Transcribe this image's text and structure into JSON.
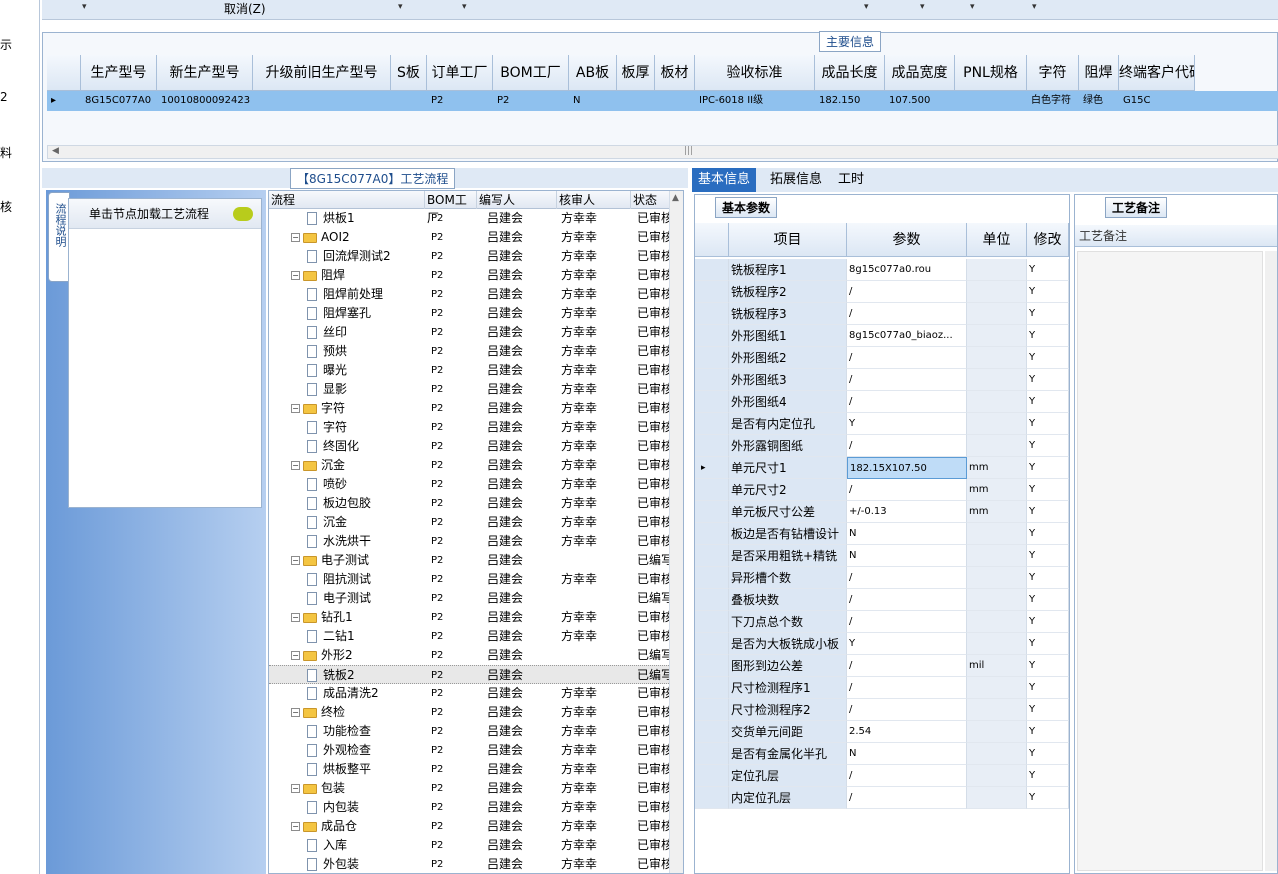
{
  "left_strip": {
    "items": [
      "示",
      "2",
      "料",
      "核"
    ]
  },
  "toolbar": {
    "cancel_label": "取消(Z)"
  },
  "main_panel": {
    "tab_label": "主要信息",
    "columns": [
      "生产型号",
      "新生产型号",
      "升级前旧生产型号",
      "S板",
      "订单工厂",
      "BOM工厂",
      "AB板",
      "板厚",
      "板材",
      "验收标准",
      "成品长度",
      "成品宽度",
      "PNL规格",
      "字符",
      "阻焊",
      "终端客户代码"
    ],
    "row": [
      "8G15C077A0",
      "10010800092423",
      "",
      "",
      "P2",
      "P2",
      "N",
      "",
      "",
      "IPC-6018 II级",
      "182.150",
      "107.500",
      "",
      "白色字符",
      "绿色",
      "G15C"
    ]
  },
  "flow": {
    "title": "【8G15C077A0】工艺流程",
    "side_tab": "流程说明",
    "node_hint": "单击节点加载工艺流程",
    "columns": [
      "流程",
      "BOM工厂",
      "编写人",
      "核审人",
      "状态"
    ],
    "rows": [
      {
        "name": "烘板1",
        "level": 2,
        "folder": false,
        "factory": "P2",
        "writer": "吕建会",
        "reviewer": "方幸幸",
        "status": "已审核"
      },
      {
        "name": "AOI2",
        "level": 1,
        "folder": true,
        "factory": "P2",
        "writer": "吕建会",
        "reviewer": "方幸幸",
        "status": "已审核"
      },
      {
        "name": "回流焊测试2",
        "level": 2,
        "folder": false,
        "factory": "P2",
        "writer": "吕建会",
        "reviewer": "方幸幸",
        "status": "已审核"
      },
      {
        "name": "阻焊",
        "level": 1,
        "folder": true,
        "factory": "P2",
        "writer": "吕建会",
        "reviewer": "方幸幸",
        "status": "已审核"
      },
      {
        "name": "阻焊前处理",
        "level": 2,
        "folder": false,
        "factory": "P2",
        "writer": "吕建会",
        "reviewer": "方幸幸",
        "status": "已审核"
      },
      {
        "name": "阻焊塞孔",
        "level": 2,
        "folder": false,
        "factory": "P2",
        "writer": "吕建会",
        "reviewer": "方幸幸",
        "status": "已审核"
      },
      {
        "name": "丝印",
        "level": 2,
        "folder": false,
        "factory": "P2",
        "writer": "吕建会",
        "reviewer": "方幸幸",
        "status": "已审核"
      },
      {
        "name": "预烘",
        "level": 2,
        "folder": false,
        "factory": "P2",
        "writer": "吕建会",
        "reviewer": "方幸幸",
        "status": "已审核"
      },
      {
        "name": "曝光",
        "level": 2,
        "folder": false,
        "factory": "P2",
        "writer": "吕建会",
        "reviewer": "方幸幸",
        "status": "已审核"
      },
      {
        "name": "显影",
        "level": 2,
        "folder": false,
        "factory": "P2",
        "writer": "吕建会",
        "reviewer": "方幸幸",
        "status": "已审核"
      },
      {
        "name": "字符",
        "level": 1,
        "folder": true,
        "factory": "P2",
        "writer": "吕建会",
        "reviewer": "方幸幸",
        "status": "已审核"
      },
      {
        "name": "字符",
        "level": 2,
        "folder": false,
        "factory": "P2",
        "writer": "吕建会",
        "reviewer": "方幸幸",
        "status": "已审核"
      },
      {
        "name": "终固化",
        "level": 2,
        "folder": false,
        "factory": "P2",
        "writer": "吕建会",
        "reviewer": "方幸幸",
        "status": "已审核"
      },
      {
        "name": "沉金",
        "level": 1,
        "folder": true,
        "factory": "P2",
        "writer": "吕建会",
        "reviewer": "方幸幸",
        "status": "已审核"
      },
      {
        "name": "喷砂",
        "level": 2,
        "folder": false,
        "factory": "P2",
        "writer": "吕建会",
        "reviewer": "方幸幸",
        "status": "已审核"
      },
      {
        "name": "板边包胶",
        "level": 2,
        "folder": false,
        "factory": "P2",
        "writer": "吕建会",
        "reviewer": "方幸幸",
        "status": "已审核"
      },
      {
        "name": "沉金",
        "level": 2,
        "folder": false,
        "factory": "P2",
        "writer": "吕建会",
        "reviewer": "方幸幸",
        "status": "已审核"
      },
      {
        "name": "水洗烘干",
        "level": 2,
        "folder": false,
        "factory": "P2",
        "writer": "吕建会",
        "reviewer": "方幸幸",
        "status": "已审核"
      },
      {
        "name": "电子测试",
        "level": 1,
        "folder": true,
        "factory": "P2",
        "writer": "吕建会",
        "reviewer": "",
        "status": "已编写"
      },
      {
        "name": "阻抗测试",
        "level": 2,
        "folder": false,
        "factory": "P2",
        "writer": "吕建会",
        "reviewer": "方幸幸",
        "status": "已审核"
      },
      {
        "name": "电子测试",
        "level": 2,
        "folder": false,
        "factory": "P2",
        "writer": "吕建会",
        "reviewer": "",
        "status": "已编写"
      },
      {
        "name": "钻孔1",
        "level": 1,
        "folder": true,
        "factory": "P2",
        "writer": "吕建会",
        "reviewer": "方幸幸",
        "status": "已审核"
      },
      {
        "name": "二钻1",
        "level": 2,
        "folder": false,
        "factory": "P2",
        "writer": "吕建会",
        "reviewer": "方幸幸",
        "status": "已审核"
      },
      {
        "name": "外形2",
        "level": 1,
        "folder": true,
        "factory": "P2",
        "writer": "吕建会",
        "reviewer": "",
        "status": "已编写"
      },
      {
        "name": "铣板2",
        "level": 2,
        "folder": false,
        "factory": "P2",
        "writer": "吕建会",
        "reviewer": "",
        "status": "已编写",
        "selected": true
      },
      {
        "name": "成品清洗2",
        "level": 2,
        "folder": false,
        "factory": "P2",
        "writer": "吕建会",
        "reviewer": "方幸幸",
        "status": "已审核"
      },
      {
        "name": "终检",
        "level": 1,
        "folder": true,
        "factory": "P2",
        "writer": "吕建会",
        "reviewer": "方幸幸",
        "status": "已审核"
      },
      {
        "name": "功能检查",
        "level": 2,
        "folder": false,
        "factory": "P2",
        "writer": "吕建会",
        "reviewer": "方幸幸",
        "status": "已审核"
      },
      {
        "name": "外观检查",
        "level": 2,
        "folder": false,
        "factory": "P2",
        "writer": "吕建会",
        "reviewer": "方幸幸",
        "status": "已审核"
      },
      {
        "name": "烘板整平",
        "level": 2,
        "folder": false,
        "factory": "P2",
        "writer": "吕建会",
        "reviewer": "方幸幸",
        "status": "已审核"
      },
      {
        "name": "包装",
        "level": 1,
        "folder": true,
        "factory": "P2",
        "writer": "吕建会",
        "reviewer": "方幸幸",
        "status": "已审核"
      },
      {
        "name": "内包装",
        "level": 2,
        "folder": false,
        "factory": "P2",
        "writer": "吕建会",
        "reviewer": "方幸幸",
        "status": "已审核"
      },
      {
        "name": "成品仓",
        "level": 1,
        "folder": true,
        "factory": "P2",
        "writer": "吕建会",
        "reviewer": "方幸幸",
        "status": "已审核"
      },
      {
        "name": "入库",
        "level": 2,
        "folder": false,
        "factory": "P2",
        "writer": "吕建会",
        "reviewer": "方幸幸",
        "status": "已审核"
      },
      {
        "name": "外包装",
        "level": 2,
        "folder": false,
        "factory": "P2",
        "writer": "吕建会",
        "reviewer": "方幸幸",
        "status": "已审核"
      }
    ]
  },
  "right_tabs": [
    "基本信息",
    "拓展信息",
    "工时"
  ],
  "params": {
    "tab_label": "基本参数",
    "columns": [
      "项目",
      "参数",
      "单位",
      "修改"
    ],
    "rows": [
      [
        "铣板程序1",
        "8g15c077a0.rou",
        "",
        "Y"
      ],
      [
        "铣板程序2",
        "/",
        "",
        "Y"
      ],
      [
        "铣板程序3",
        "/",
        "",
        "Y"
      ],
      [
        "外形图纸1",
        "8g15c077a0_biaoz...",
        "",
        "Y"
      ],
      [
        "外形图纸2",
        "/",
        "",
        "Y"
      ],
      [
        "外形图纸3",
        "/",
        "",
        "Y"
      ],
      [
        "外形图纸4",
        "/",
        "",
        "Y"
      ],
      [
        "是否有内定位孔",
        "Y",
        "",
        "Y"
      ],
      [
        "外形露铜图纸",
        "/",
        "",
        "Y"
      ],
      [
        "单元尺寸1",
        "182.15X107.50",
        "mm",
        "Y"
      ],
      [
        "单元尺寸2",
        "/",
        "mm",
        "Y"
      ],
      [
        "单元板尺寸公差",
        "+/-0.13",
        "mm",
        "Y"
      ],
      [
        "板边是否有钻槽设计",
        "N",
        "",
        "Y"
      ],
      [
        "是否采用粗铣+精铣",
        "N",
        "",
        "Y"
      ],
      [
        "异形槽个数",
        "/",
        "",
        "Y"
      ],
      [
        "叠板块数",
        "/",
        "",
        "Y"
      ],
      [
        "下刀点总个数",
        "/",
        "",
        "Y"
      ],
      [
        "是否为大板铣成小板",
        "Y",
        "",
        "Y"
      ],
      [
        "图形到边公差",
        "/",
        "mil",
        "Y"
      ],
      [
        "尺寸检测程序1",
        "/",
        "",
        "Y"
      ],
      [
        "尺寸检测程序2",
        "/",
        "",
        "Y"
      ],
      [
        "交货单元间距",
        "2.54",
        "",
        "Y"
      ],
      [
        "是否有金属化半孔",
        "N",
        "",
        "Y"
      ],
      [
        "定位孔层",
        "/",
        "",
        "Y"
      ],
      [
        "内定位孔层",
        "/",
        "",
        "Y"
      ]
    ]
  },
  "remark": {
    "tab_label": "工艺备注",
    "column": "工艺备注"
  },
  "colors": {
    "selected_row": "#8fc1ee",
    "active_tab": "#2a6dc0",
    "header_bg": "#dce7f4"
  }
}
